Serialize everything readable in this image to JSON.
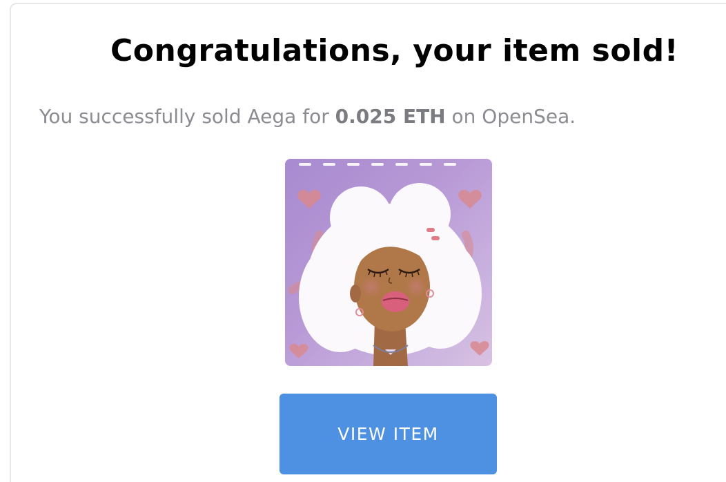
{
  "dialog": {
    "title": "Congratulations, your item sold!",
    "message_prefix": "You successfully sold Aega for ",
    "price": "0.025 ETH",
    "message_suffix": " on OpenSea."
  },
  "item": {
    "image_icon": "nft-portrait-illustration"
  },
  "actions": {
    "view_item_label": "VIEW ITEM"
  },
  "colors": {
    "button_background": "#4e90e1",
    "title_text": "#000000",
    "message_text": "#8a8c91"
  }
}
